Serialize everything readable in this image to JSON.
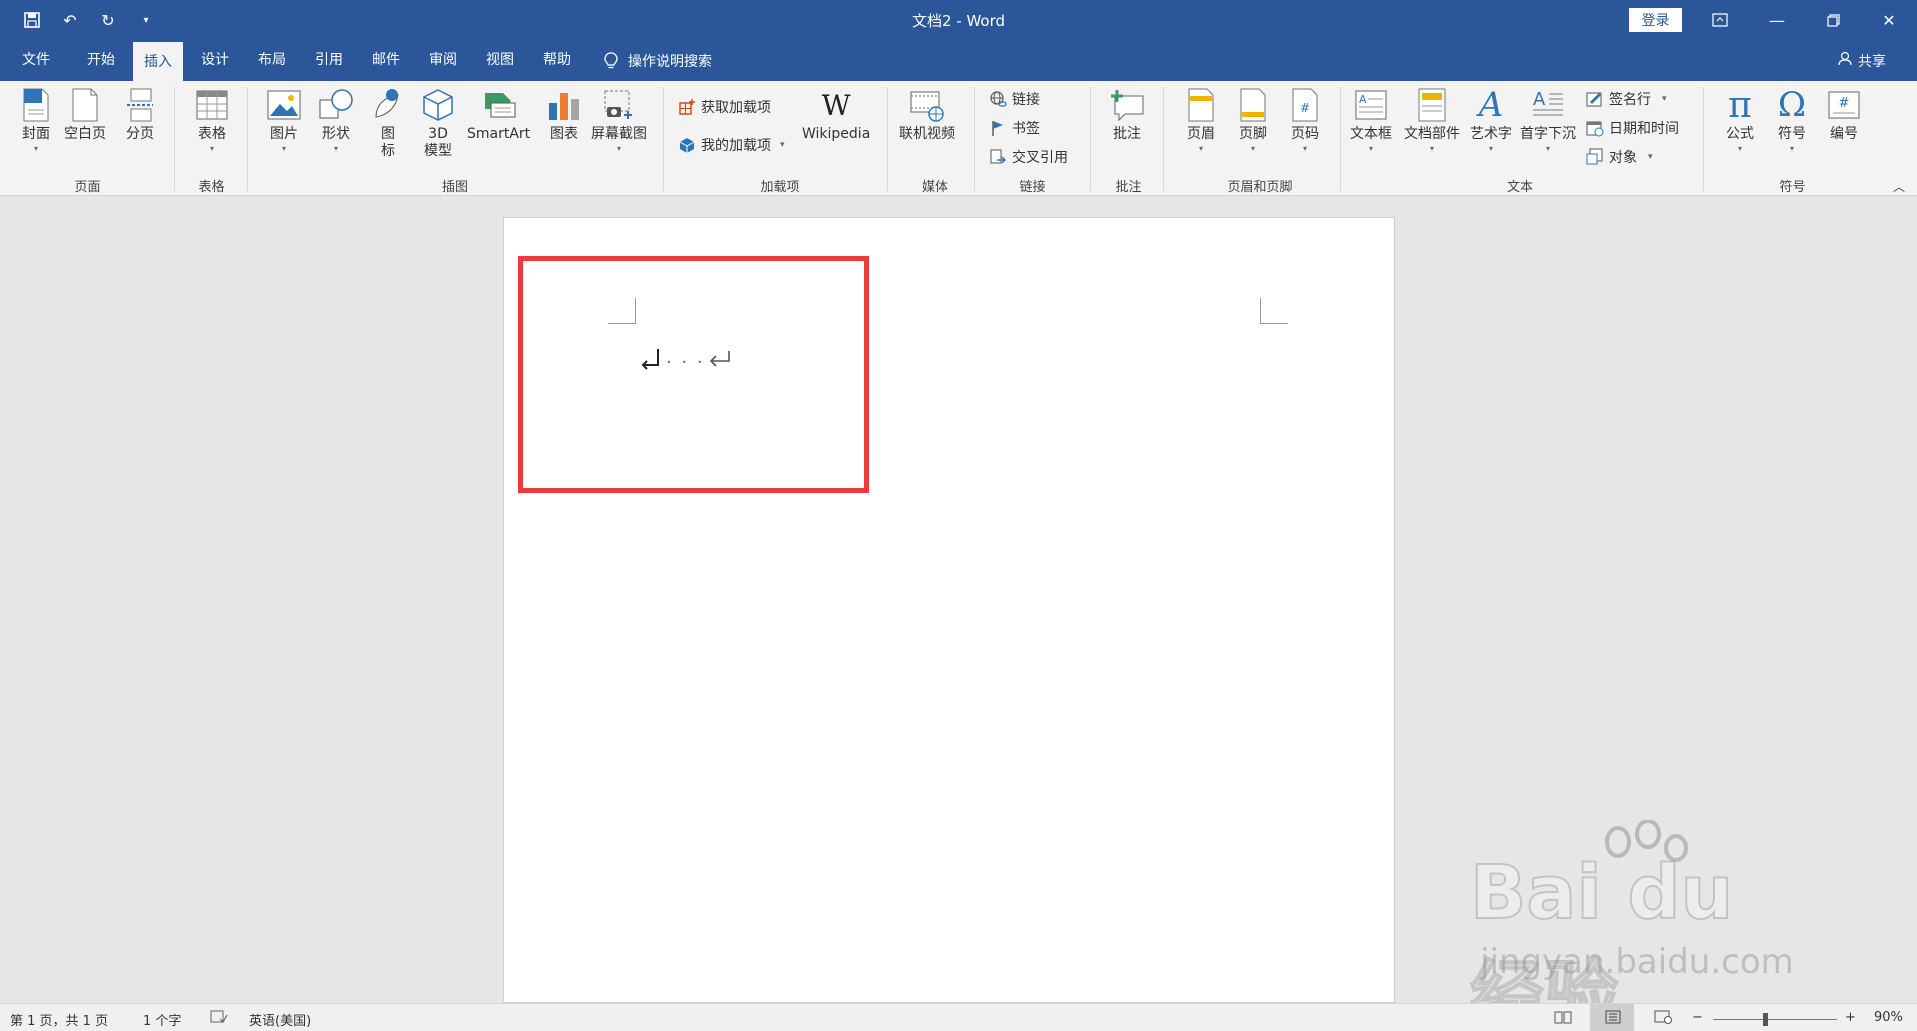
{
  "window": {
    "title": "文档2  -  Word",
    "login_label": "登录"
  },
  "tabs": [
    "文件",
    "开始",
    "插入",
    "设计",
    "布局",
    "引用",
    "邮件",
    "审阅",
    "视图",
    "帮助"
  ],
  "active_tab": "插入",
  "search": {
    "label": "操作说明搜索"
  },
  "share": {
    "label": "共享"
  },
  "ribbon": {
    "pages": {
      "label": "页面",
      "cover": "封面",
      "blank": "空白页",
      "break": "分页"
    },
    "tables": {
      "label": "表格",
      "table": "表格"
    },
    "illustrations": {
      "label": "插图",
      "picture": "图片",
      "shapes": "形状",
      "icons_line1": "图",
      "icons_line2": "标",
      "model_line1": "3D",
      "model_line2": "模型",
      "smartart": "SmartArt",
      "chart": "图表",
      "screenshot": "屏幕截图"
    },
    "addins": {
      "label": "加载项",
      "get": "获取加载项",
      "my": "我的加载项",
      "wikipedia": "Wikipedia"
    },
    "media": {
      "label": "媒体",
      "video": "联机视频"
    },
    "links": {
      "label": "链接",
      "link": "链接",
      "bookmark": "书签",
      "crossref": "交叉引用"
    },
    "comments": {
      "label": "批注",
      "comment": "批注"
    },
    "header_footer": {
      "label": "页眉和页脚",
      "header": "页眉",
      "footer": "页脚",
      "page_number": "页码"
    },
    "text": {
      "label": "文本",
      "textbox": "文本框",
      "quickparts": "文档部件",
      "wordart": "艺术字",
      "dropcap": "首字下沉",
      "signature": "签名行",
      "datetime": "日期和时间",
      "object": "对象"
    },
    "symbols": {
      "label": "符号",
      "equation": "公式",
      "symbol": "符号",
      "number": "编号"
    }
  },
  "document": {
    "dots": "· · ·"
  },
  "watermark": {
    "brand": "Bai du 经验",
    "url": "jingyan.baidu.com"
  },
  "status": {
    "page": "第 1 页，共 1 页",
    "words": "1 个字",
    "language": "英语(美国)",
    "zoom_level": "90%",
    "zoom_fraction": 0.42
  },
  "colors": {
    "brand": "#2b579a",
    "highlight": "#ee3a3b"
  }
}
